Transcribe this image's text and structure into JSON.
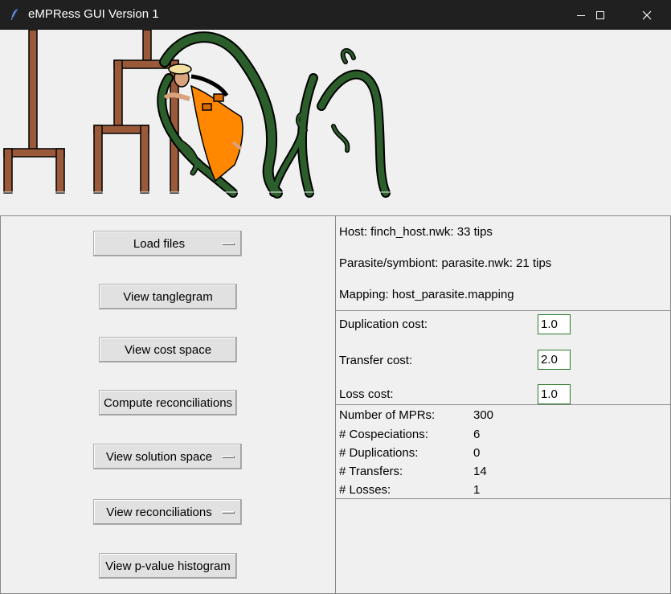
{
  "window": {
    "title": "eMPRess GUI Version 1",
    "icons": {
      "app": "feather-icon",
      "minimize": "minimize-icon",
      "maximize": "maximize-icon",
      "close": "close-icon"
    }
  },
  "buttons": {
    "load_files": "Load files",
    "view_tanglegram": "View tanglegram",
    "view_cost_space": "View cost space",
    "compute_reconciliations": "Compute reconciliations",
    "view_solution_space": "View solution space",
    "view_reconciliations": "View reconciliations",
    "view_pvalue_histogram": "View p-value histogram"
  },
  "files": {
    "host": "Host: finch_host.nwk: 33 tips",
    "parasite": "Parasite/symbiont: parasite.nwk: 21 tips",
    "mapping": "Mapping: host_parasite.mapping"
  },
  "costs": {
    "duplication_label": "Duplication cost:",
    "duplication_value": "1.0",
    "transfer_label": "Transfer cost:",
    "transfer_value": "2.0",
    "loss_label": "Loss cost:",
    "loss_value": "1.0"
  },
  "results": [
    {
      "label": "Number of MPRs:",
      "value": "300"
    },
    {
      "label": "# Cospeciations:",
      "value": "6"
    },
    {
      "label": "# Duplications:",
      "value": "0"
    },
    {
      "label": "# Transfers:",
      "value": "14"
    },
    {
      "label": "# Losses:",
      "value": "1"
    }
  ],
  "colors": {
    "titlebar": "#202020",
    "tree_brown": "#9a5a3a",
    "vine_green": "#2b5e2b",
    "dress_orange": "#ff8800",
    "entry_border": "#2a7a2a"
  }
}
